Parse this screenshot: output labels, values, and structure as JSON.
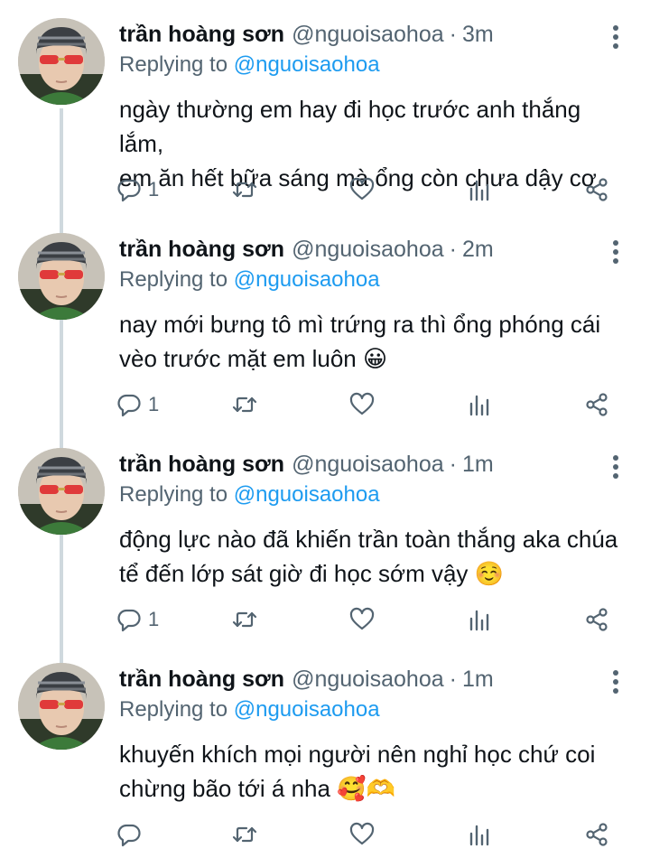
{
  "tweets": [
    {
      "name": "trần hoàng sơn",
      "handle": "@nguoisaohoa",
      "separator": "·",
      "time": "3m",
      "replying_prefix": "Replying to",
      "replying_to": "@nguoisaohoa",
      "lines": [
        "ngày thường em hay đi học trước anh thắng lắm,",
        "em ăn hết bữa sáng mà ổng còn chưa dậy cơ"
      ],
      "emoji": "",
      "reply_count": "1"
    },
    {
      "name": "trần hoàng sơn",
      "handle": "@nguoisaohoa",
      "separator": "·",
      "time": "2m",
      "replying_prefix": "Replying to",
      "replying_to": "@nguoisaohoa",
      "lines": [
        "nay mới bưng tô mì trứng ra thì ổng phóng cái",
        "vèo trước mặt em luôn"
      ],
      "emoji": "😀",
      "reply_count": "1"
    },
    {
      "name": "trần hoàng sơn",
      "handle": "@nguoisaohoa",
      "separator": "·",
      "time": "1m",
      "replying_prefix": "Replying to",
      "replying_to": "@nguoisaohoa",
      "lines": [
        "động lực nào đã khiến trần toàn thắng aka chúa",
        "tể đến lớp sát giờ đi học sớm vậy"
      ],
      "emoji": "☺️",
      "reply_count": "1"
    },
    {
      "name": "trần hoàng sơn",
      "handle": "@nguoisaohoa",
      "separator": "·",
      "time": "1m",
      "replying_prefix": "Replying to",
      "replying_to": "@nguoisaohoa",
      "lines": [
        "khuyến khích mọi người nên nghỉ học chứ coi",
        "chừng bão tới á nha"
      ],
      "emoji": "🥰🫶",
      "reply_count": ""
    }
  ],
  "icons": {
    "more": "more-vertical-icon",
    "reply": "reply-icon",
    "retweet": "retweet-icon",
    "like": "heart-icon",
    "views": "analytics-icon",
    "share": "share-icon"
  },
  "colors": {
    "text": "#0f1419",
    "secondary": "#536471",
    "accent": "#1d9bf0",
    "thread_line": "#cfd9de"
  }
}
